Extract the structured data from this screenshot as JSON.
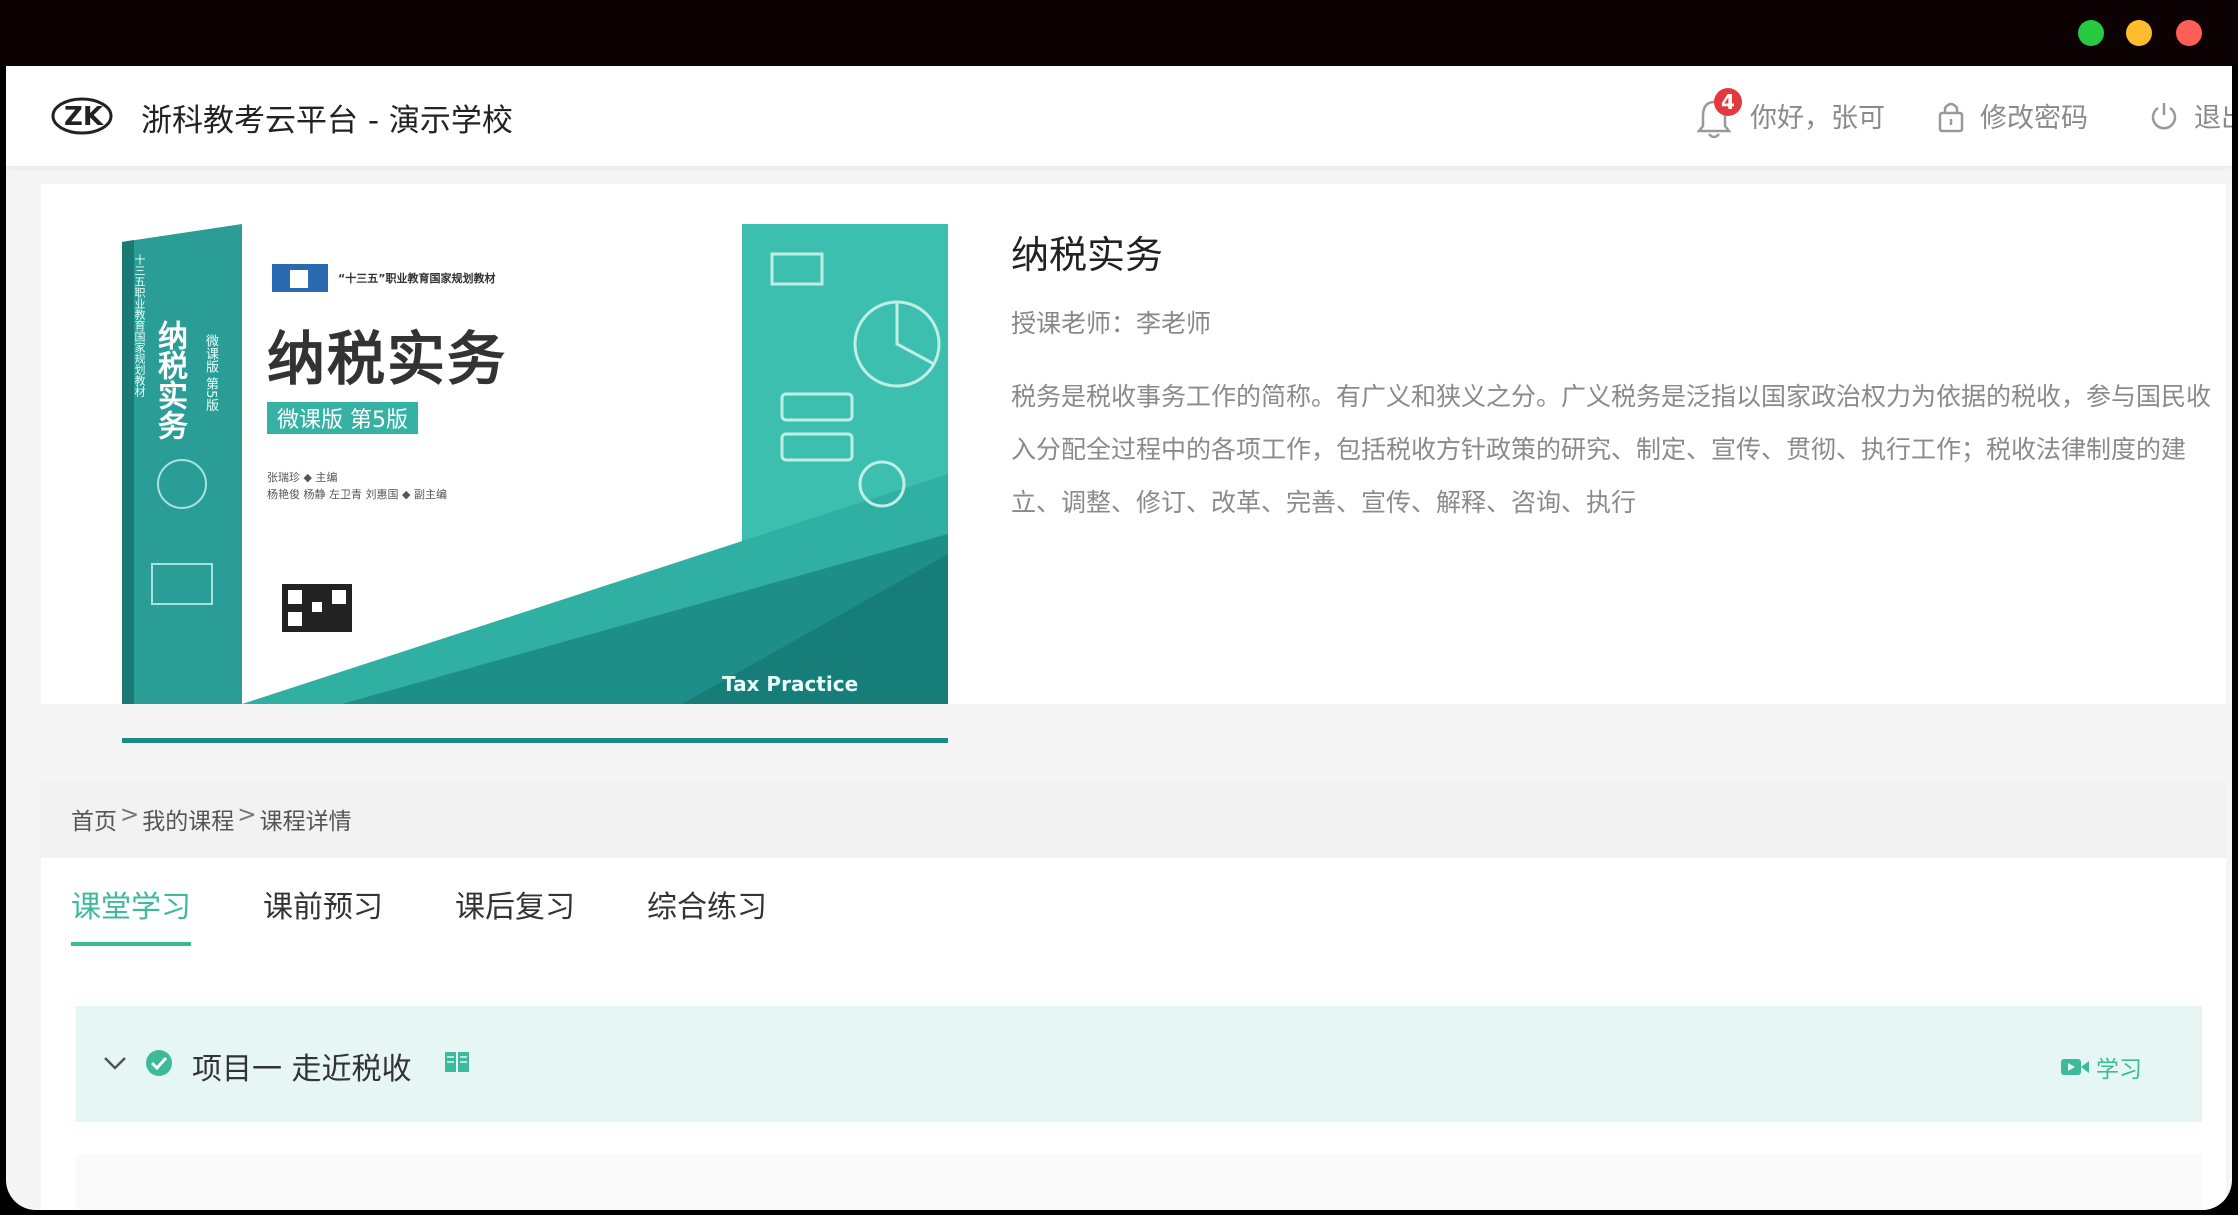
{
  "header": {
    "site_title": "浙科教考云平台 - 演示学校",
    "notification_count": "4",
    "greeting": "你好，张可",
    "change_password": "修改密码",
    "logout": "退出"
  },
  "course": {
    "title": "纳税实务",
    "teacher": "授课老师：李老师",
    "description": "税务是税收事务工作的简称。有广义和狭义之分。广义税务是泛指以国家政治权力为依据的税收，参与国民收入分配全过程中的各项工作，包括税收方针政策的研究、制定、宣传、贯彻、执行工作；税收法律制度的建立、调整、修订、改革、完善、宣传、解释、咨询、执行",
    "cover": {
      "series": "“十三五”职业教育国家规划教材",
      "title": "纳税实务",
      "edition": "微课版 第5版",
      "authors_line1": "张瑞珍 ◆ 主编",
      "authors_line2": "杨艳俊 杨静 左卫青 刘惠国 ◆ 副主编",
      "english_title": "Tax Practice",
      "spine_title": "纳税实务",
      "spine_edition": "微课版 第5版",
      "spine_series": "十三五职业教育国家规划教材"
    }
  },
  "breadcrumb": {
    "home": "首页",
    "my_courses": "我的课程",
    "current": "课程详情",
    "separator": ">"
  },
  "tabs": [
    {
      "label": "课堂学习",
      "active": true
    },
    {
      "label": "课前预习",
      "active": false
    },
    {
      "label": "课后复习",
      "active": false
    },
    {
      "label": "综合练习",
      "active": false
    }
  ],
  "project": {
    "title": "项目一 走近税收",
    "study_label": "学习"
  },
  "colors": {
    "accent": "#3dba9c",
    "badge": "#e4393c",
    "traffic_green": "#27c93f",
    "traffic_yellow": "#ffbd2e",
    "traffic_red": "#ff5f56",
    "book_teal": "#35b2a4"
  }
}
